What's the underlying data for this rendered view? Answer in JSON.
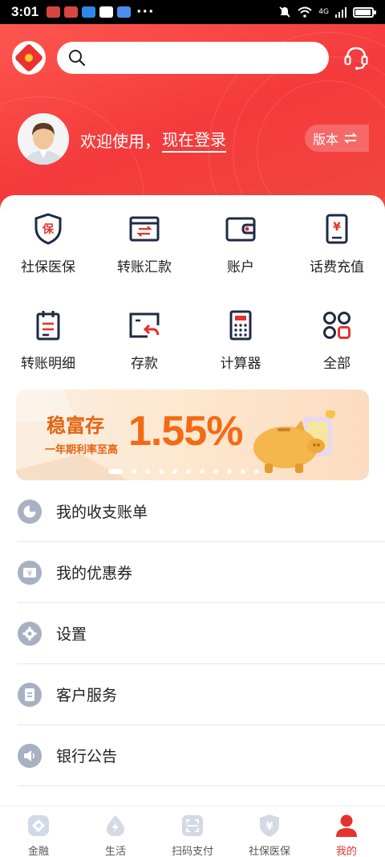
{
  "status_bar": {
    "time": "3:01",
    "dots": "···",
    "network": "4G"
  },
  "search": {
    "placeholder": ""
  },
  "user": {
    "welcome": "欢迎使用，",
    "login": "现在登录",
    "version": "版本"
  },
  "quick_grid": [
    {
      "label": "社保医保",
      "icon": "social-insurance-shield-icon",
      "glyph": "保"
    },
    {
      "label": "转账汇款",
      "icon": "transfer-icon"
    },
    {
      "label": "账户",
      "icon": "wallet-icon"
    },
    {
      "label": "话费充值",
      "icon": "phone-topup-icon",
      "glyph": "¥"
    },
    {
      "label": "转账明细",
      "icon": "transfer-detail-icon"
    },
    {
      "label": "存款",
      "icon": "deposit-icon"
    },
    {
      "label": "计算器",
      "icon": "calculator-icon"
    },
    {
      "label": "全部",
      "icon": "all-apps-icon"
    }
  ],
  "banner": {
    "title": "稳富存",
    "subtitle": "一年期利率至高",
    "rate": "1.55%",
    "slide_count": 11,
    "active_slide": 1
  },
  "menu": [
    {
      "label": "我的收支账单",
      "icon": "pie-chart-icon"
    },
    {
      "label": "我的优惠券",
      "icon": "coupon-icon"
    },
    {
      "label": "设置",
      "icon": "gear-icon"
    },
    {
      "label": "客户服务",
      "icon": "document-icon"
    },
    {
      "label": "银行公告",
      "icon": "speaker-icon"
    }
  ],
  "tabs": [
    {
      "label": "金融",
      "icon": "finance-icon",
      "active": false
    },
    {
      "label": "生活",
      "icon": "life-icon",
      "active": false
    },
    {
      "label": "扫码支付",
      "icon": "scan-pay-icon",
      "active": false
    },
    {
      "label": "社保医保",
      "icon": "shield-yuan-icon",
      "active": false
    },
    {
      "label": "我的",
      "icon": "user-icon",
      "active": true
    }
  ],
  "colors": {
    "brand_red": "#f43a3c",
    "icon_navy": "#1f2a44",
    "accent_red": "#e5322e",
    "banner_orange": "#f36a14",
    "menu_icon_gray": "#a8b0c2"
  }
}
